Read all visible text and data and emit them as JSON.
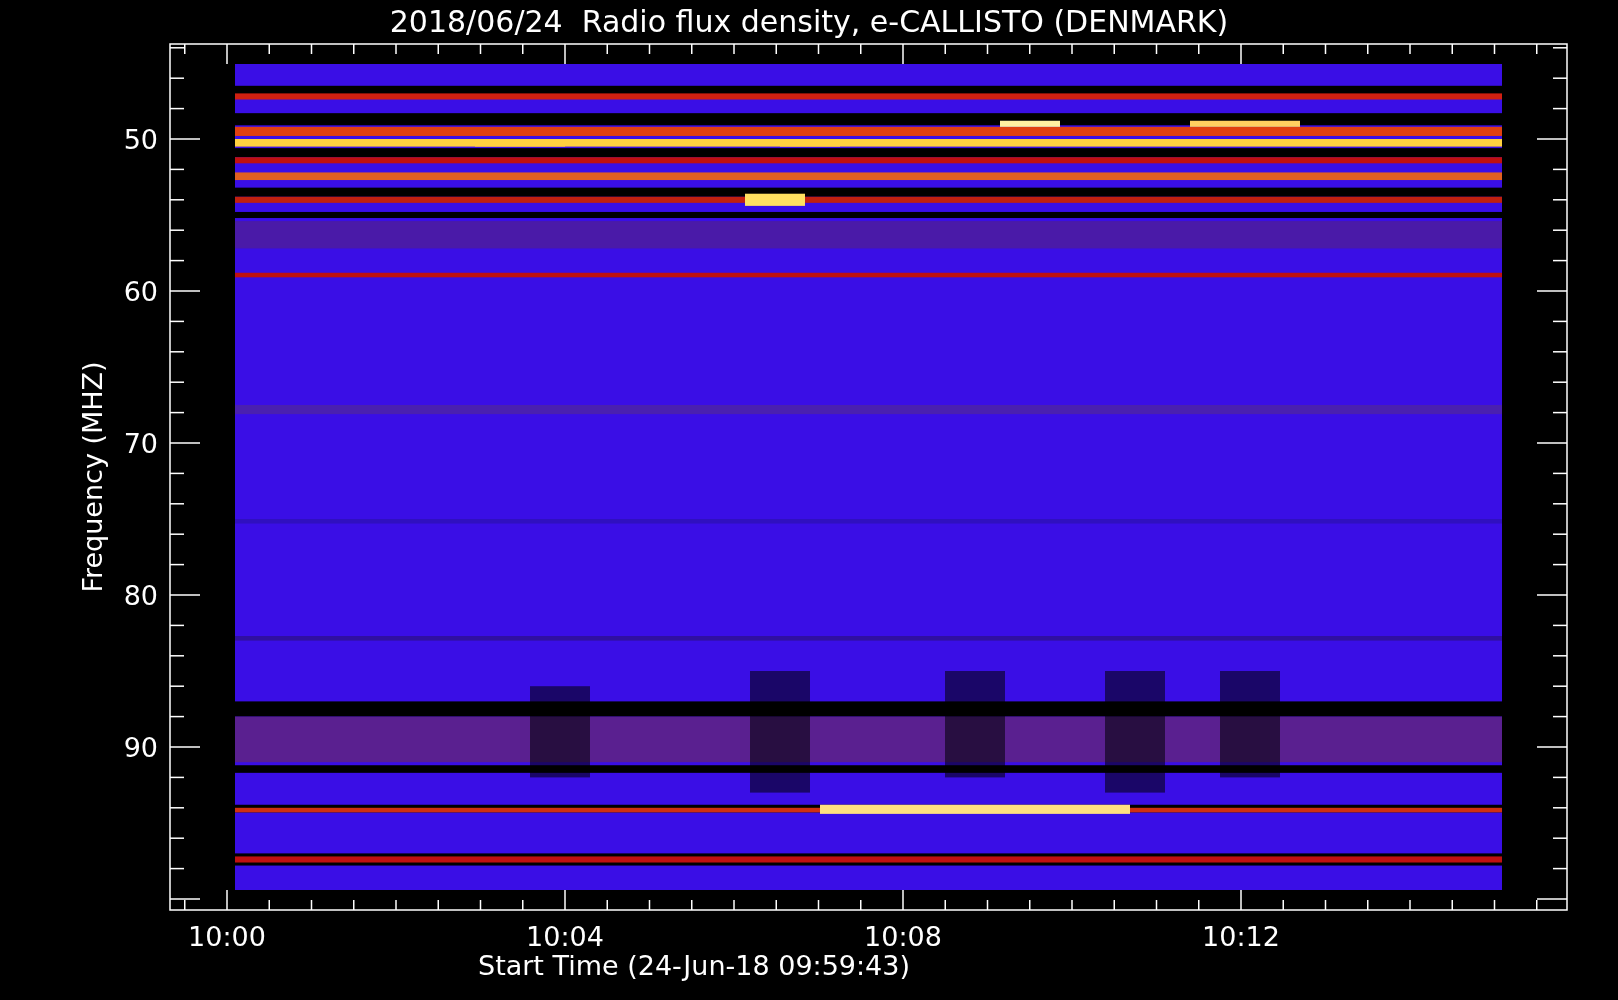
{
  "title": "2018/06/24  Radio flux density, e-CALLISTO (DENMARK)",
  "y_axis": {
    "label": "Frequency (MHZ)",
    "ticks": [
      "50",
      "60",
      "70",
      "80",
      "90"
    ]
  },
  "x_axis": {
    "label": "Start Time (24-Jun-18 09:59:43)",
    "ticks": [
      "10:00",
      "10:04",
      "10:08",
      "10:12"
    ]
  }
}
